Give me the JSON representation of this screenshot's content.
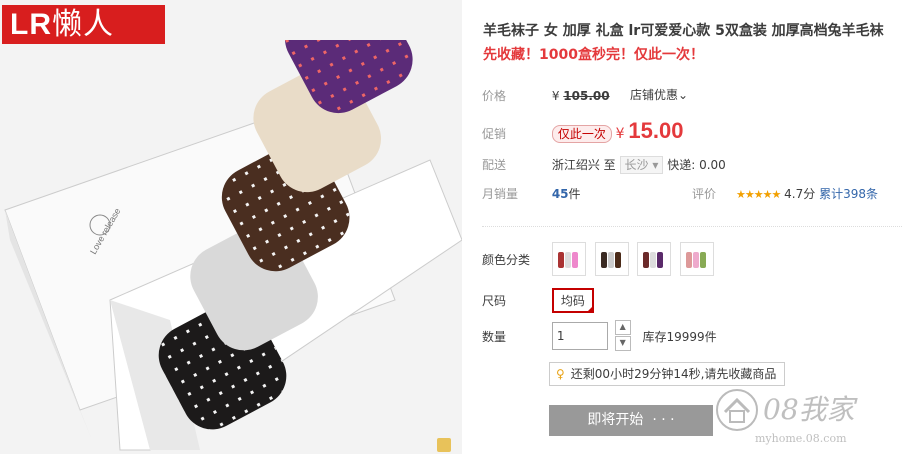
{
  "logo": {
    "latin": "LR",
    "cjk": "懒人"
  },
  "product": {
    "title": "羊毛袜子 女 加厚 礼盒 lr可爱爱心款 5双盒装 加厚高档兔羊毛袜",
    "subtitle": "先收藏！1000盒秒完！仅此一次！",
    "box_brand": "Love release"
  },
  "price": {
    "label": "价格",
    "currency": "¥",
    "original": "105.00",
    "shop_discount": "店铺优惠"
  },
  "promo": {
    "label": "促销",
    "tag": "仅此一次",
    "currency": "¥",
    "value": "15.00"
  },
  "delivery": {
    "label": "配送",
    "from": "浙江绍兴",
    "to_word": "至",
    "dest": "长沙",
    "express": "快递: 0.00"
  },
  "sales": {
    "label": "月销量",
    "count": "45",
    "unit": "件",
    "rating_label": "评价",
    "stars": "★★★★★",
    "score": "4.7分",
    "total": "累计398条"
  },
  "options": {
    "color_label": "颜色分类",
    "swatch_colors": [
      [
        "#a33",
        "#c87",
        "#ddd",
        "#e8c",
        "#a36"
      ],
      [
        "#3a2a22",
        "#ccc",
        "#eee",
        "#4a2a18",
        "#ddd"
      ],
      [
        "#6b2a2a",
        "#ddd",
        "#5a2a6a",
        "#ddd",
        "#c99"
      ],
      [
        "#d99",
        "#ccc",
        "#eac",
        "#caa",
        "#8a5"
      ]
    ],
    "size_label": "尺码",
    "size_value": "均码",
    "qty_label": "数量",
    "qty_value": "1",
    "stock": "库存19999件"
  },
  "notice": {
    "icon": "bulb-icon",
    "text": "还剩00小时29分钟14秒,请先收藏商品"
  },
  "buy_button": {
    "label": "即将开始",
    "dots": "· · ·"
  },
  "watermark": {
    "brand": "08我家",
    "url": "myhome.08.com"
  }
}
